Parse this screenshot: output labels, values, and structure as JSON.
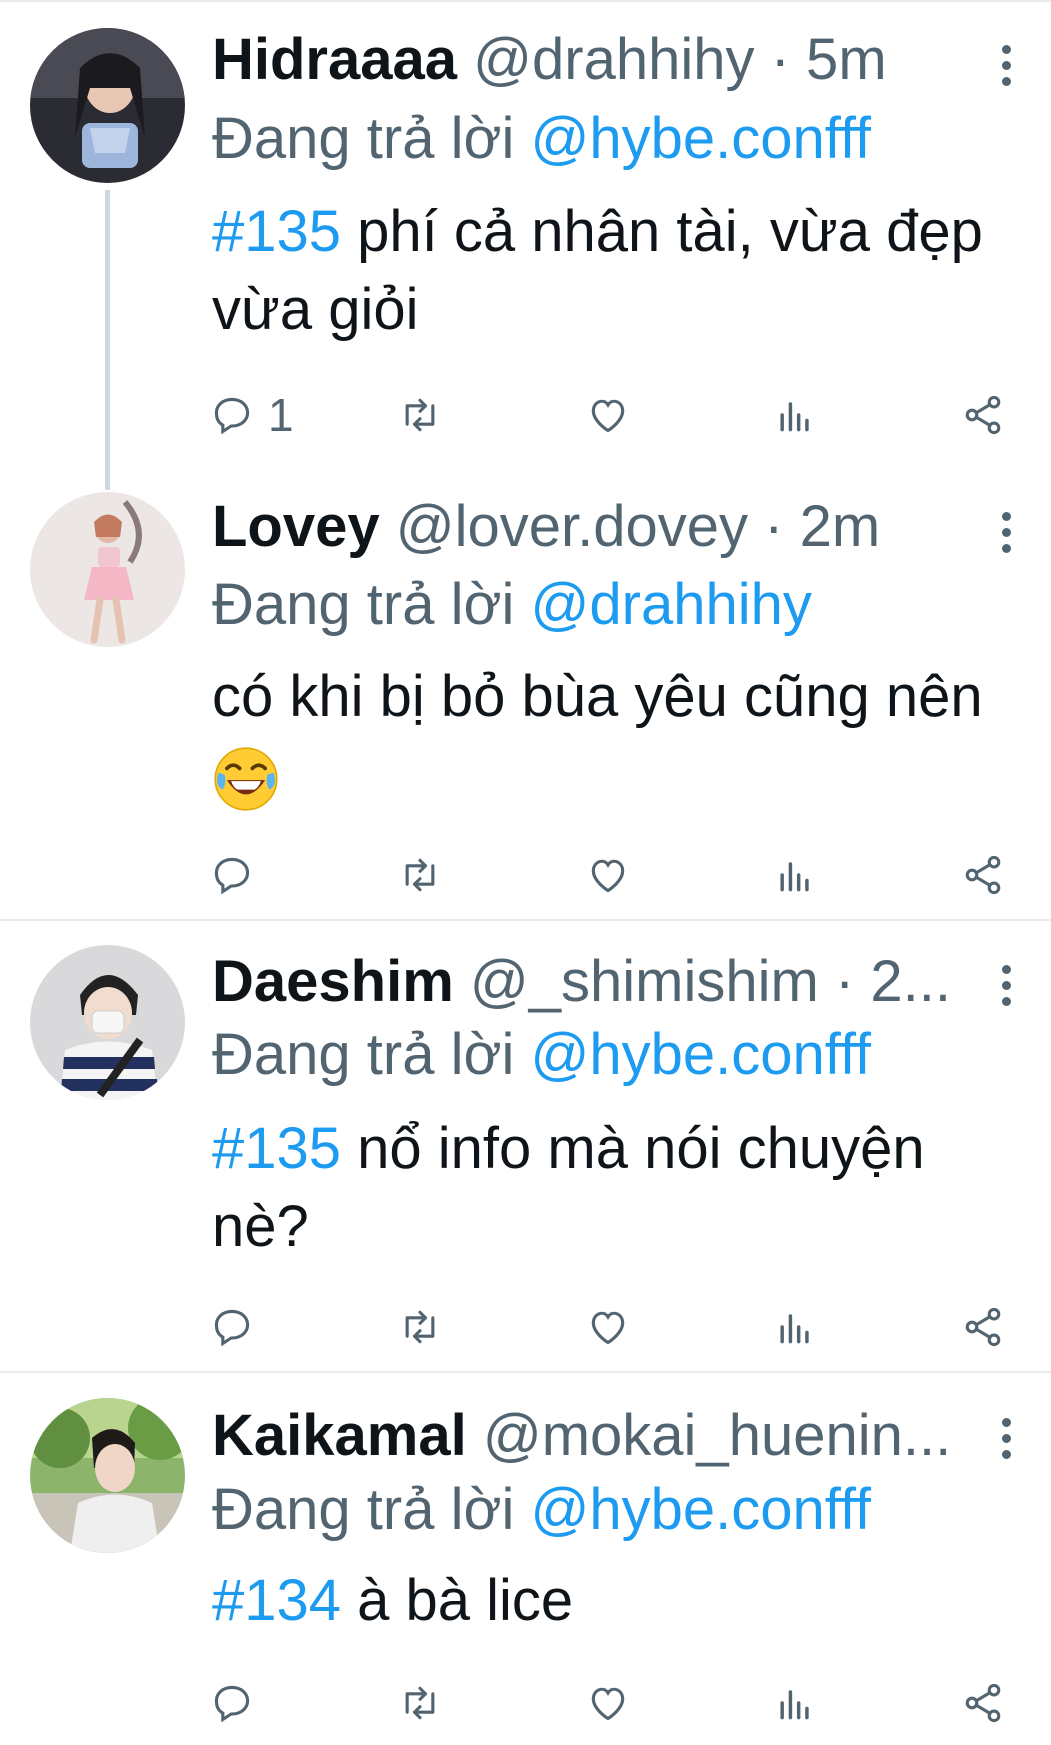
{
  "colors": {
    "link": "#1d9bf0",
    "muted": "#536471",
    "text": "#0f1419",
    "divider": "#e6ecf0"
  },
  "reply_prefix": "Đang trả lời",
  "tweets": [
    {
      "name": "Hidraaaa",
      "handle": "@drahhihy · 5m",
      "reply_to": "@hybe.confff",
      "hashtag": "#135",
      "text": " phí cả nhân tài, vừa đẹp vừa giỏi",
      "reply_count": "1",
      "avatar_icon": "avatar-photo-girl-blue-top"
    },
    {
      "name": "Lovey",
      "handle": "@lover.dovey · 2m",
      "reply_to": "@drahhihy",
      "hashtag": "",
      "text": "có khi bị bỏ bùa yêu cũng nên",
      "emoji": "face-with-tears-of-joy",
      "reply_count": "",
      "avatar_icon": "avatar-photo-girl-pink-outfit"
    },
    {
      "name": "Daeshim",
      "handle": "@_shimishim · 2...",
      "reply_to": "@hybe.confff",
      "hashtag": "#135",
      "text": " nổ info mà nói chuyện nè?",
      "reply_count": "",
      "avatar_icon": "avatar-photo-person-striped-sweater"
    },
    {
      "name": "Kaikamal",
      "handle": "@mokai_huenin...",
      "reply_to": "@hybe.confff",
      "hashtag": "#134",
      "text": " à bà lice",
      "reply_count": "",
      "avatar_icon": "avatar-photo-person-outdoors"
    }
  ],
  "action_icons": [
    "reply-icon",
    "retweet-icon",
    "like-icon",
    "views-icon",
    "share-icon"
  ]
}
